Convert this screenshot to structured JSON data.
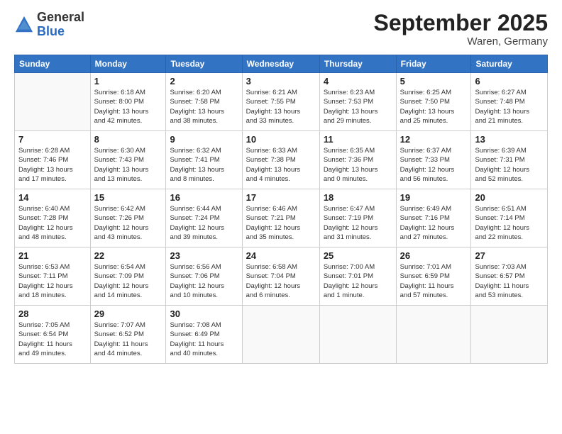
{
  "logo": {
    "general": "General",
    "blue": "Blue"
  },
  "header": {
    "month": "September 2025",
    "location": "Waren, Germany"
  },
  "days_of_week": [
    "Sunday",
    "Monday",
    "Tuesday",
    "Wednesday",
    "Thursday",
    "Friday",
    "Saturday"
  ],
  "weeks": [
    [
      {
        "day": "",
        "info": ""
      },
      {
        "day": "1",
        "info": "Sunrise: 6:18 AM\nSunset: 8:00 PM\nDaylight: 13 hours\nand 42 minutes."
      },
      {
        "day": "2",
        "info": "Sunrise: 6:20 AM\nSunset: 7:58 PM\nDaylight: 13 hours\nand 38 minutes."
      },
      {
        "day": "3",
        "info": "Sunrise: 6:21 AM\nSunset: 7:55 PM\nDaylight: 13 hours\nand 33 minutes."
      },
      {
        "day": "4",
        "info": "Sunrise: 6:23 AM\nSunset: 7:53 PM\nDaylight: 13 hours\nand 29 minutes."
      },
      {
        "day": "5",
        "info": "Sunrise: 6:25 AM\nSunset: 7:50 PM\nDaylight: 13 hours\nand 25 minutes."
      },
      {
        "day": "6",
        "info": "Sunrise: 6:27 AM\nSunset: 7:48 PM\nDaylight: 13 hours\nand 21 minutes."
      }
    ],
    [
      {
        "day": "7",
        "info": "Sunrise: 6:28 AM\nSunset: 7:46 PM\nDaylight: 13 hours\nand 17 minutes."
      },
      {
        "day": "8",
        "info": "Sunrise: 6:30 AM\nSunset: 7:43 PM\nDaylight: 13 hours\nand 13 minutes."
      },
      {
        "day": "9",
        "info": "Sunrise: 6:32 AM\nSunset: 7:41 PM\nDaylight: 13 hours\nand 8 minutes."
      },
      {
        "day": "10",
        "info": "Sunrise: 6:33 AM\nSunset: 7:38 PM\nDaylight: 13 hours\nand 4 minutes."
      },
      {
        "day": "11",
        "info": "Sunrise: 6:35 AM\nSunset: 7:36 PM\nDaylight: 13 hours\nand 0 minutes."
      },
      {
        "day": "12",
        "info": "Sunrise: 6:37 AM\nSunset: 7:33 PM\nDaylight: 12 hours\nand 56 minutes."
      },
      {
        "day": "13",
        "info": "Sunrise: 6:39 AM\nSunset: 7:31 PM\nDaylight: 12 hours\nand 52 minutes."
      }
    ],
    [
      {
        "day": "14",
        "info": "Sunrise: 6:40 AM\nSunset: 7:28 PM\nDaylight: 12 hours\nand 48 minutes."
      },
      {
        "day": "15",
        "info": "Sunrise: 6:42 AM\nSunset: 7:26 PM\nDaylight: 12 hours\nand 43 minutes."
      },
      {
        "day": "16",
        "info": "Sunrise: 6:44 AM\nSunset: 7:24 PM\nDaylight: 12 hours\nand 39 minutes."
      },
      {
        "day": "17",
        "info": "Sunrise: 6:46 AM\nSunset: 7:21 PM\nDaylight: 12 hours\nand 35 minutes."
      },
      {
        "day": "18",
        "info": "Sunrise: 6:47 AM\nSunset: 7:19 PM\nDaylight: 12 hours\nand 31 minutes."
      },
      {
        "day": "19",
        "info": "Sunrise: 6:49 AM\nSunset: 7:16 PM\nDaylight: 12 hours\nand 27 minutes."
      },
      {
        "day": "20",
        "info": "Sunrise: 6:51 AM\nSunset: 7:14 PM\nDaylight: 12 hours\nand 22 minutes."
      }
    ],
    [
      {
        "day": "21",
        "info": "Sunrise: 6:53 AM\nSunset: 7:11 PM\nDaylight: 12 hours\nand 18 minutes."
      },
      {
        "day": "22",
        "info": "Sunrise: 6:54 AM\nSunset: 7:09 PM\nDaylight: 12 hours\nand 14 minutes."
      },
      {
        "day": "23",
        "info": "Sunrise: 6:56 AM\nSunset: 7:06 PM\nDaylight: 12 hours\nand 10 minutes."
      },
      {
        "day": "24",
        "info": "Sunrise: 6:58 AM\nSunset: 7:04 PM\nDaylight: 12 hours\nand 6 minutes."
      },
      {
        "day": "25",
        "info": "Sunrise: 7:00 AM\nSunset: 7:01 PM\nDaylight: 12 hours\nand 1 minute."
      },
      {
        "day": "26",
        "info": "Sunrise: 7:01 AM\nSunset: 6:59 PM\nDaylight: 11 hours\nand 57 minutes."
      },
      {
        "day": "27",
        "info": "Sunrise: 7:03 AM\nSunset: 6:57 PM\nDaylight: 11 hours\nand 53 minutes."
      }
    ],
    [
      {
        "day": "28",
        "info": "Sunrise: 7:05 AM\nSunset: 6:54 PM\nDaylight: 11 hours\nand 49 minutes."
      },
      {
        "day": "29",
        "info": "Sunrise: 7:07 AM\nSunset: 6:52 PM\nDaylight: 11 hours\nand 44 minutes."
      },
      {
        "day": "30",
        "info": "Sunrise: 7:08 AM\nSunset: 6:49 PM\nDaylight: 11 hours\nand 40 minutes."
      },
      {
        "day": "",
        "info": ""
      },
      {
        "day": "",
        "info": ""
      },
      {
        "day": "",
        "info": ""
      },
      {
        "day": "",
        "info": ""
      }
    ]
  ]
}
